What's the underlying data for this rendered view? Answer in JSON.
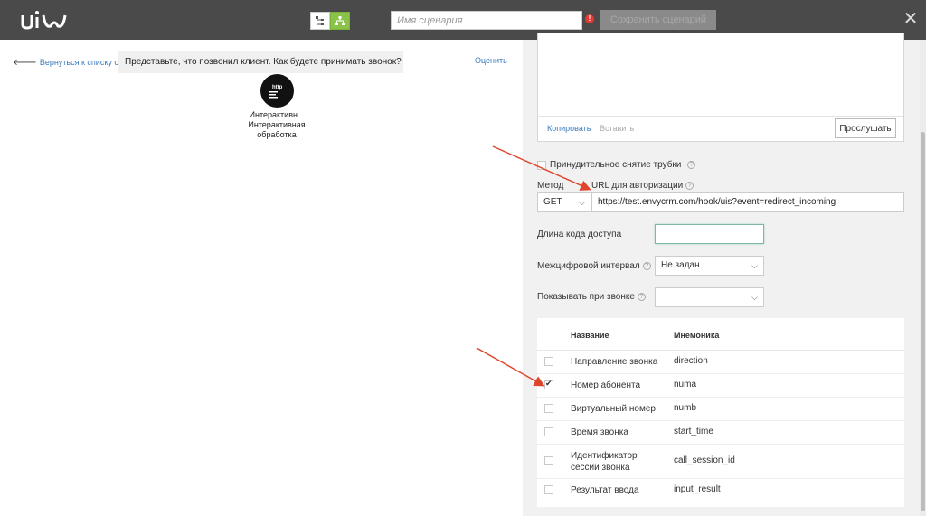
{
  "header": {
    "scenario_placeholder": "Имя сценария",
    "warning_mark": "!",
    "save_label": "Сохранить сценарий",
    "close_glyph": "✕"
  },
  "left": {
    "back_label": "Вернуться к списку сцена",
    "back_arrow": "🡐",
    "prompt": "Представьте, что позвонил клиент. Как будете принимать звонок?",
    "rate_label": "Оценить",
    "node_icon_text": "http",
    "node_label_line1": "Интерактивн...",
    "node_label_line2": "Интерактивная",
    "node_label_line3": "обработка"
  },
  "right": {
    "copy_label": "Копировать",
    "paste_label": "Вставить",
    "listen_label": "Прослушать",
    "force_pickup_label": "Принудительное снятие трубки",
    "method_label": "Метод",
    "url_label": "URL для авторизации",
    "method_value": "GET",
    "url_value": "https://test.envycrm.com/hook/uis?event=redirect_incoming",
    "code_length_label": "Длина кода доступа",
    "code_length_value": "",
    "interdigit_label": "Межцифровой интервал",
    "interdigit_value": "Не задан",
    "show_on_call_label": "Показывать при звонке",
    "show_on_call_value": "",
    "help_glyph": "?",
    "chevron_glyph": "⌵"
  },
  "table": {
    "col_name": "Название",
    "col_mnemonic": "Мнемоника",
    "rows": [
      {
        "name": "Направление звонка",
        "name2": "",
        "mnemonic": "direction",
        "checked": false
      },
      {
        "name": "Номер абонента",
        "name2": "",
        "mnemonic": "numa",
        "checked": true
      },
      {
        "name": "Виртуальный номер",
        "name2": "",
        "mnemonic": "numb",
        "checked": false
      },
      {
        "name": "Время звонка",
        "name2": "",
        "mnemonic": "start_time",
        "checked": false
      },
      {
        "name": "Идентификатор",
        "name2": "сессии звонка",
        "mnemonic": "call_session_id",
        "checked": false
      },
      {
        "name": "Результат ввода",
        "name2": "",
        "mnemonic": "input_result",
        "checked": false
      }
    ]
  },
  "colors": {
    "topbar": "#4a4a4a",
    "accent_green": "#8bc34a",
    "link_blue": "#3a7bbf",
    "arrow_red": "#e0452c"
  }
}
